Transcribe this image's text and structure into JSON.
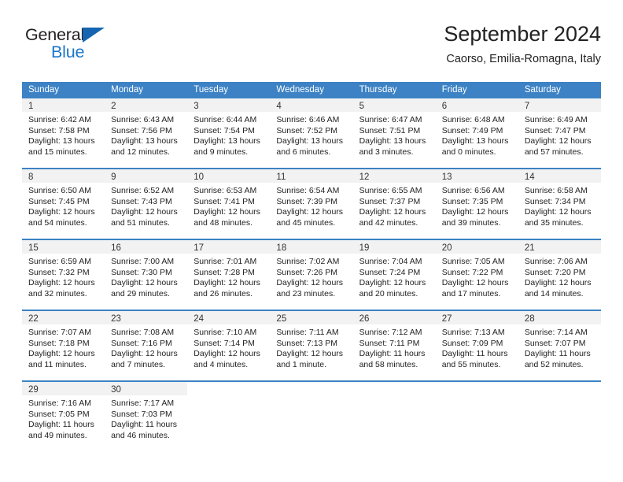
{
  "brand": {
    "name_part1": "General",
    "name_part2": "Blue",
    "accent_color": "#1b76c9",
    "triangle_color": "#1565b0"
  },
  "header": {
    "title": "September 2024",
    "subtitle": "Caorso, Emilia-Romagna, Italy"
  },
  "calendar": {
    "header_bg": "#3c82c4",
    "weekdays": [
      "Sunday",
      "Monday",
      "Tuesday",
      "Wednesday",
      "Thursday",
      "Friday",
      "Saturday"
    ],
    "weeks": [
      [
        {
          "day": "1",
          "sunrise": "Sunrise: 6:42 AM",
          "sunset": "Sunset: 7:58 PM",
          "daylight1": "Daylight: 13 hours",
          "daylight2": "and 15 minutes."
        },
        {
          "day": "2",
          "sunrise": "Sunrise: 6:43 AM",
          "sunset": "Sunset: 7:56 PM",
          "daylight1": "Daylight: 13 hours",
          "daylight2": "and 12 minutes."
        },
        {
          "day": "3",
          "sunrise": "Sunrise: 6:44 AM",
          "sunset": "Sunset: 7:54 PM",
          "daylight1": "Daylight: 13 hours",
          "daylight2": "and 9 minutes."
        },
        {
          "day": "4",
          "sunrise": "Sunrise: 6:46 AM",
          "sunset": "Sunset: 7:52 PM",
          "daylight1": "Daylight: 13 hours",
          "daylight2": "and 6 minutes."
        },
        {
          "day": "5",
          "sunrise": "Sunrise: 6:47 AM",
          "sunset": "Sunset: 7:51 PM",
          "daylight1": "Daylight: 13 hours",
          "daylight2": "and 3 minutes."
        },
        {
          "day": "6",
          "sunrise": "Sunrise: 6:48 AM",
          "sunset": "Sunset: 7:49 PM",
          "daylight1": "Daylight: 13 hours",
          "daylight2": "and 0 minutes."
        },
        {
          "day": "7",
          "sunrise": "Sunrise: 6:49 AM",
          "sunset": "Sunset: 7:47 PM",
          "daylight1": "Daylight: 12 hours",
          "daylight2": "and 57 minutes."
        }
      ],
      [
        {
          "day": "8",
          "sunrise": "Sunrise: 6:50 AM",
          "sunset": "Sunset: 7:45 PM",
          "daylight1": "Daylight: 12 hours",
          "daylight2": "and 54 minutes."
        },
        {
          "day": "9",
          "sunrise": "Sunrise: 6:52 AM",
          "sunset": "Sunset: 7:43 PM",
          "daylight1": "Daylight: 12 hours",
          "daylight2": "and 51 minutes."
        },
        {
          "day": "10",
          "sunrise": "Sunrise: 6:53 AM",
          "sunset": "Sunset: 7:41 PM",
          "daylight1": "Daylight: 12 hours",
          "daylight2": "and 48 minutes."
        },
        {
          "day": "11",
          "sunrise": "Sunrise: 6:54 AM",
          "sunset": "Sunset: 7:39 PM",
          "daylight1": "Daylight: 12 hours",
          "daylight2": "and 45 minutes."
        },
        {
          "day": "12",
          "sunrise": "Sunrise: 6:55 AM",
          "sunset": "Sunset: 7:37 PM",
          "daylight1": "Daylight: 12 hours",
          "daylight2": "and 42 minutes."
        },
        {
          "day": "13",
          "sunrise": "Sunrise: 6:56 AM",
          "sunset": "Sunset: 7:35 PM",
          "daylight1": "Daylight: 12 hours",
          "daylight2": "and 39 minutes."
        },
        {
          "day": "14",
          "sunrise": "Sunrise: 6:58 AM",
          "sunset": "Sunset: 7:34 PM",
          "daylight1": "Daylight: 12 hours",
          "daylight2": "and 35 minutes."
        }
      ],
      [
        {
          "day": "15",
          "sunrise": "Sunrise: 6:59 AM",
          "sunset": "Sunset: 7:32 PM",
          "daylight1": "Daylight: 12 hours",
          "daylight2": "and 32 minutes."
        },
        {
          "day": "16",
          "sunrise": "Sunrise: 7:00 AM",
          "sunset": "Sunset: 7:30 PM",
          "daylight1": "Daylight: 12 hours",
          "daylight2": "and 29 minutes."
        },
        {
          "day": "17",
          "sunrise": "Sunrise: 7:01 AM",
          "sunset": "Sunset: 7:28 PM",
          "daylight1": "Daylight: 12 hours",
          "daylight2": "and 26 minutes."
        },
        {
          "day": "18",
          "sunrise": "Sunrise: 7:02 AM",
          "sunset": "Sunset: 7:26 PM",
          "daylight1": "Daylight: 12 hours",
          "daylight2": "and 23 minutes."
        },
        {
          "day": "19",
          "sunrise": "Sunrise: 7:04 AM",
          "sunset": "Sunset: 7:24 PM",
          "daylight1": "Daylight: 12 hours",
          "daylight2": "and 20 minutes."
        },
        {
          "day": "20",
          "sunrise": "Sunrise: 7:05 AM",
          "sunset": "Sunset: 7:22 PM",
          "daylight1": "Daylight: 12 hours",
          "daylight2": "and 17 minutes."
        },
        {
          "day": "21",
          "sunrise": "Sunrise: 7:06 AM",
          "sunset": "Sunset: 7:20 PM",
          "daylight1": "Daylight: 12 hours",
          "daylight2": "and 14 minutes."
        }
      ],
      [
        {
          "day": "22",
          "sunrise": "Sunrise: 7:07 AM",
          "sunset": "Sunset: 7:18 PM",
          "daylight1": "Daylight: 12 hours",
          "daylight2": "and 11 minutes."
        },
        {
          "day": "23",
          "sunrise": "Sunrise: 7:08 AM",
          "sunset": "Sunset: 7:16 PM",
          "daylight1": "Daylight: 12 hours",
          "daylight2": "and 7 minutes."
        },
        {
          "day": "24",
          "sunrise": "Sunrise: 7:10 AM",
          "sunset": "Sunset: 7:14 PM",
          "daylight1": "Daylight: 12 hours",
          "daylight2": "and 4 minutes."
        },
        {
          "day": "25",
          "sunrise": "Sunrise: 7:11 AM",
          "sunset": "Sunset: 7:13 PM",
          "daylight1": "Daylight: 12 hours",
          "daylight2": "and 1 minute."
        },
        {
          "day": "26",
          "sunrise": "Sunrise: 7:12 AM",
          "sunset": "Sunset: 7:11 PM",
          "daylight1": "Daylight: 11 hours",
          "daylight2": "and 58 minutes."
        },
        {
          "day": "27",
          "sunrise": "Sunrise: 7:13 AM",
          "sunset": "Sunset: 7:09 PM",
          "daylight1": "Daylight: 11 hours",
          "daylight2": "and 55 minutes."
        },
        {
          "day": "28",
          "sunrise": "Sunrise: 7:14 AM",
          "sunset": "Sunset: 7:07 PM",
          "daylight1": "Daylight: 11 hours",
          "daylight2": "and 52 minutes."
        }
      ],
      [
        {
          "day": "29",
          "sunrise": "Sunrise: 7:16 AM",
          "sunset": "Sunset: 7:05 PM",
          "daylight1": "Daylight: 11 hours",
          "daylight2": "and 49 minutes."
        },
        {
          "day": "30",
          "sunrise": "Sunrise: 7:17 AM",
          "sunset": "Sunset: 7:03 PM",
          "daylight1": "Daylight: 11 hours",
          "daylight2": "and 46 minutes."
        },
        {
          "day": "",
          "sunrise": "",
          "sunset": "",
          "daylight1": "",
          "daylight2": ""
        },
        {
          "day": "",
          "sunrise": "",
          "sunset": "",
          "daylight1": "",
          "daylight2": ""
        },
        {
          "day": "",
          "sunrise": "",
          "sunset": "",
          "daylight1": "",
          "daylight2": ""
        },
        {
          "day": "",
          "sunrise": "",
          "sunset": "",
          "daylight1": "",
          "daylight2": ""
        },
        {
          "day": "",
          "sunrise": "",
          "sunset": "",
          "daylight1": "",
          "daylight2": ""
        }
      ]
    ]
  }
}
